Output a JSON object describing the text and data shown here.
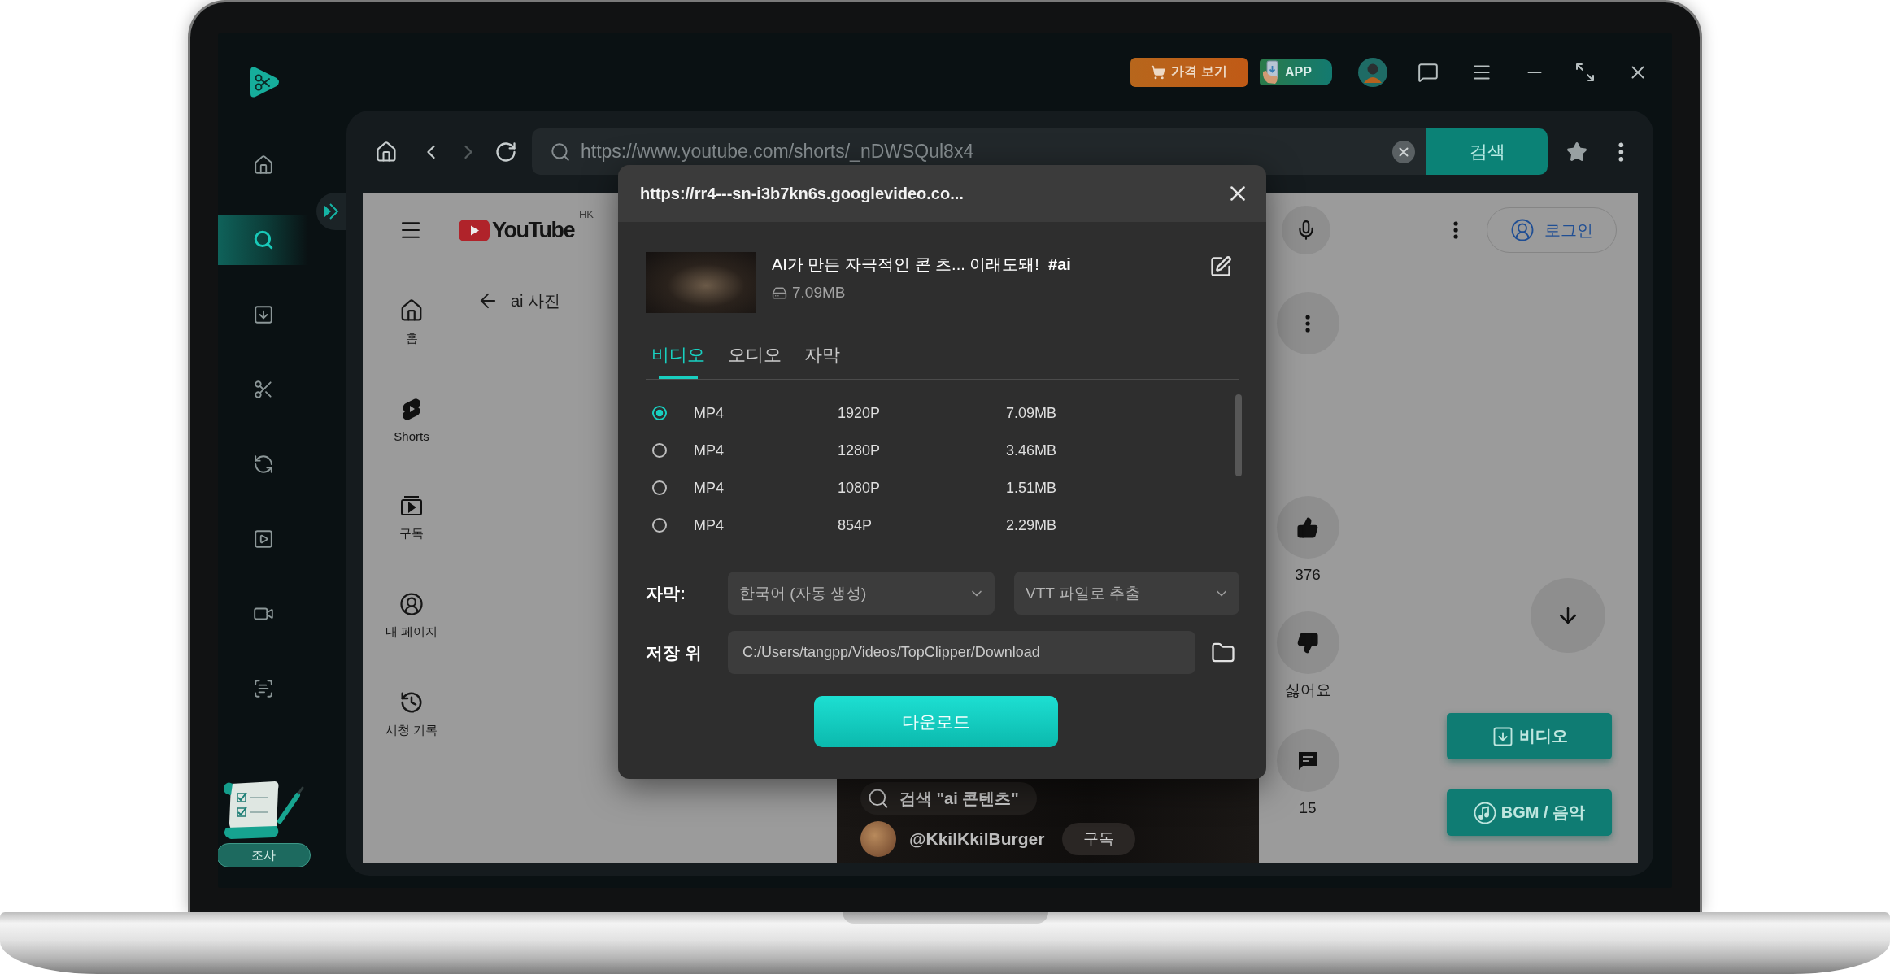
{
  "app": {
    "sidebar": {
      "items": [
        {
          "selected": false
        },
        {
          "selected": true
        },
        {
          "selected": false
        },
        {
          "selected": false
        },
        {
          "selected": false
        },
        {
          "selected": false
        },
        {
          "selected": false
        },
        {
          "selected": false
        }
      ],
      "survey_button": "조사"
    },
    "top_bar": {
      "price_button": "가격 보기",
      "app_badge": "APP"
    }
  },
  "browser": {
    "forward_disabled": true,
    "url": "https://www.youtube.com/shorts/_nDWSQul8x4",
    "search_button": "검색"
  },
  "youtube": {
    "logo_text": "YouTube",
    "region": "HK",
    "login_button": "로그인",
    "nav": [
      {
        "label": "홈"
      },
      {
        "label": "Shorts"
      },
      {
        "label": "구독"
      },
      {
        "label": "내 페이지"
      },
      {
        "label": "시청 기록"
      }
    ],
    "back_title": "ai 사진",
    "actions": [
      {
        "label": "376"
      },
      {
        "label": "싫어요"
      },
      {
        "label": "15"
      }
    ],
    "video": {
      "search": "검색 \"ai 콘텐츠\"",
      "channel": "@KkilKkilBurger",
      "subscribe": "구독"
    },
    "float_buttons": [
      {
        "label": "비디오"
      },
      {
        "label": "BGM / 음악"
      }
    ]
  },
  "dialog": {
    "title": "https://rr4---sn-i3b7kn6s.googlevideo.co...",
    "video_title": "AI가 만든 자극적인 콘 츠... 이래도돼!  **#ai**",
    "file_size": "7.09MB",
    "tabs": [
      {
        "label": "비디오",
        "selected": true
      },
      {
        "label": "오디오",
        "selected": false
      },
      {
        "label": "자막",
        "selected": false
      }
    ],
    "formats": [
      {
        "format": "MP4",
        "resolution": "1920P",
        "size": "7.09MB",
        "selected": true
      },
      {
        "format": "MP4",
        "resolution": "1280P",
        "size": "3.46MB",
        "selected": false
      },
      {
        "format": "MP4",
        "resolution": "1080P",
        "size": "1.51MB",
        "selected": false
      },
      {
        "format": "MP4",
        "resolution": "854P",
        "size": "2.29MB",
        "selected": false
      }
    ],
    "subtitle_label": "자막:",
    "subtitle_language": "한국어 (자동 생성)",
    "subtitle_export": "VTT 파일로 추출",
    "save_label": "저장 위",
    "save_path": "C:/Users/tangpp/Videos/TopClipper/Download",
    "download_button": "다운로드"
  }
}
